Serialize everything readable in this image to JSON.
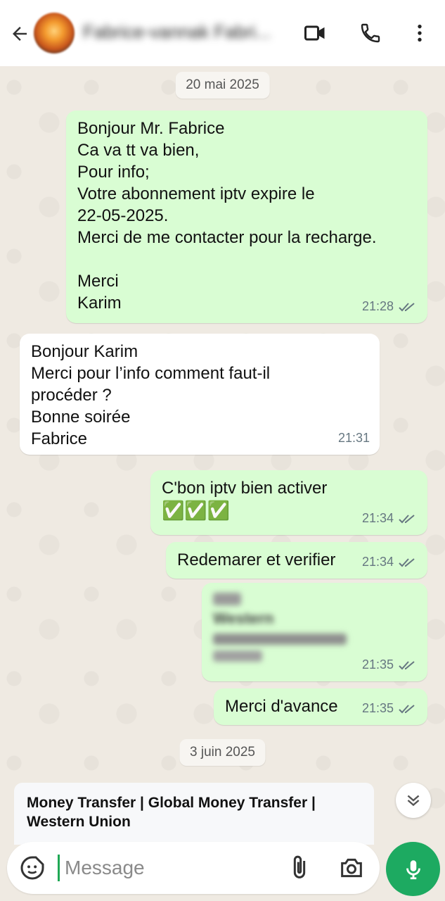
{
  "header": {
    "contact_name": "Fabrice-vannak Fabri..."
  },
  "chat": {
    "date_1": "20 mai 2025",
    "date_2": "3 juin 2025",
    "messages": [
      {
        "dir": "out",
        "text": "Bonjour Mr. Fabrice\nCa va tt va bien,\nPour info;\nVotre abonnement iptv expire le\n22-05-2025.\nMerci de me contacter pour la recharge.\n\nMerci\nKarim",
        "time": "21:28"
      },
      {
        "dir": "in",
        "text": "Bonjour Karim\nMerci pour l’info comment faut-il\nprocéder ?\nBonne soirée\nFabrice",
        "time": "21:31"
      },
      {
        "dir": "out",
        "text": "C'bon  iptv bien activer",
        "emoji": "✅✅✅",
        "time": "21:34"
      },
      {
        "dir": "out",
        "text": "Redemarer et verifier",
        "time": "21:34"
      },
      {
        "dir": "out",
        "text": "Western",
        "time": "21:35"
      },
      {
        "dir": "out",
        "text": "Merci d'avance",
        "time": "21:35"
      }
    ],
    "link_preview": {
      "title": "Money Transfer | Global Money Transfer | Western Union"
    }
  },
  "composer": {
    "placeholder": "Message"
  },
  "colors": {
    "outgoing_bubble": "#d9fdd3",
    "incoming_bubble": "#ffffff",
    "accent_green": "#1daa61",
    "read_ticks": "#667781"
  },
  "icons": [
    "back-arrow-icon",
    "video-call-icon",
    "phone-icon",
    "more-vert-icon",
    "double-check-icon",
    "chevron-double-down-icon",
    "sticker-icon",
    "attach-icon",
    "camera-icon",
    "mic-icon"
  ]
}
